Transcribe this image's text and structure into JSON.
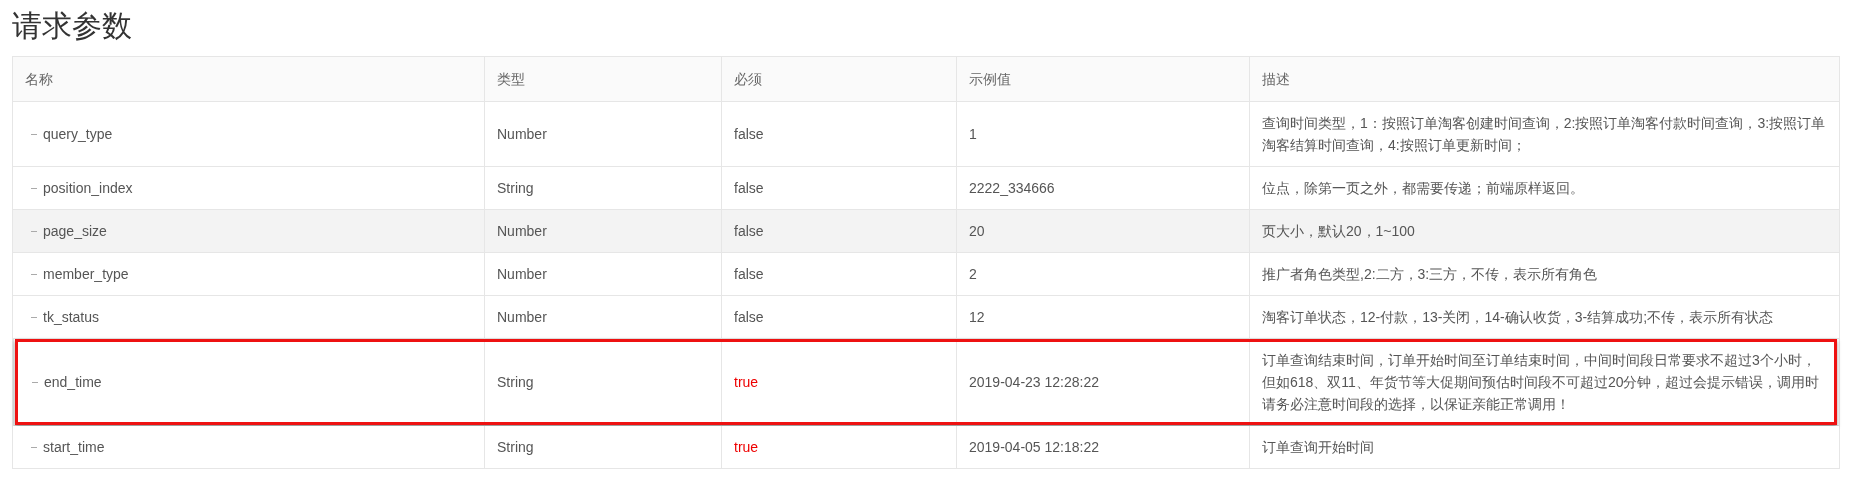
{
  "title": "请求参数",
  "table": {
    "columns": [
      "名称",
      "类型",
      "必须",
      "示例值",
      "描述"
    ],
    "rows": [
      {
        "name": "query_type",
        "type": "Number",
        "required": {
          "text": "false",
          "emphasis": false
        },
        "example": "1",
        "description": "查询时间类型，1：按照订单淘客创建时间查询，2:按照订单淘客付款时间查询，3:按照订单淘客结算时间查询，4:按照订单更新时间；",
        "hovered": false,
        "highlighted": false
      },
      {
        "name": "position_index",
        "type": "String",
        "required": {
          "text": "false",
          "emphasis": false
        },
        "example": "2222_334666",
        "description": "位点，除第一页之外，都需要传递；前端原样返回。",
        "hovered": false,
        "highlighted": false
      },
      {
        "name": "page_size",
        "type": "Number",
        "required": {
          "text": "false",
          "emphasis": false
        },
        "example": "20",
        "description": "页大小，默认20，1~100",
        "hovered": true,
        "highlighted": false
      },
      {
        "name": "member_type",
        "type": "Number",
        "required": {
          "text": "false",
          "emphasis": false
        },
        "example": "2",
        "description": "推广者角色类型,2:二方，3:三方，不传，表示所有角色",
        "hovered": false,
        "highlighted": false
      },
      {
        "name": "tk_status",
        "type": "Number",
        "required": {
          "text": "false",
          "emphasis": false
        },
        "example": "12",
        "description": "淘客订单状态，12-付款，13-关闭，14-确认收货，3-结算成功;不传，表示所有状态",
        "hovered": false,
        "highlighted": false
      },
      {
        "name": "end_time",
        "type": "String",
        "required": {
          "text": "true",
          "emphasis": true
        },
        "example": "2019-04-23 12:28:22",
        "description": "订单查询结束时间，订单开始时间至订单结束时间，中间时间段日常要求不超过3个小时，但如618、双11、年货节等大促期间预估时间段不可超过20分钟，超过会提示错误，调用时请务必注意时间段的选择，以保证亲能正常调用！",
        "hovered": false,
        "highlighted": true
      },
      {
        "name": "start_time",
        "type": "String",
        "required": {
          "text": "true",
          "emphasis": true
        },
        "example": "2019-04-05 12:18:22",
        "description": "订单查询开始时间",
        "hovered": false,
        "highlighted": false
      }
    ]
  }
}
